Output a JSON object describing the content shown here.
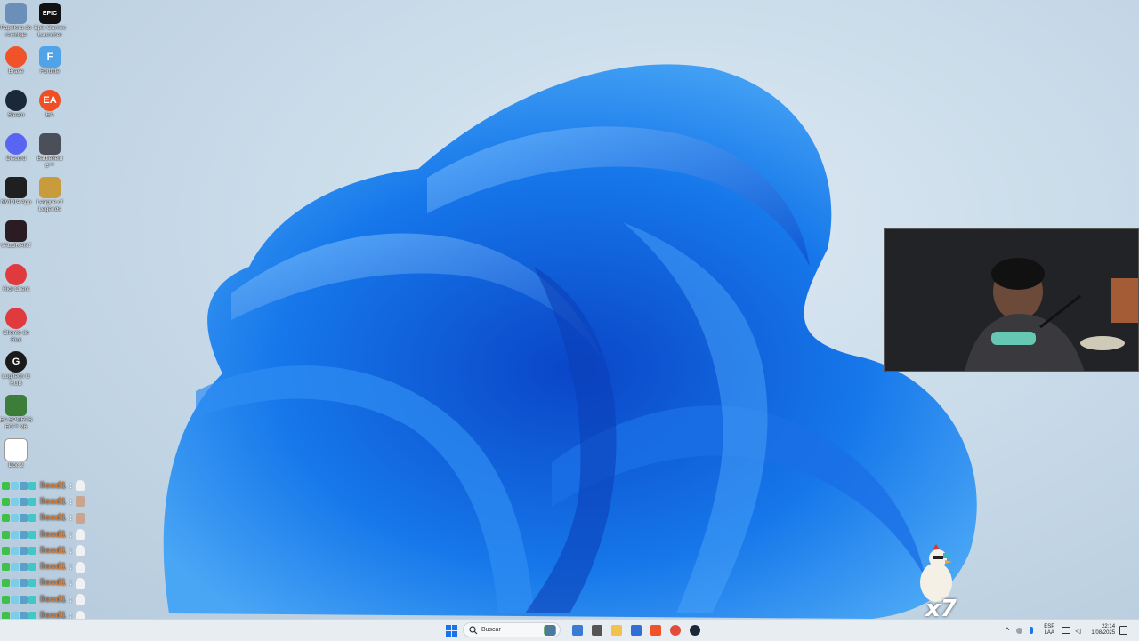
{
  "desktop_icons": [
    {
      "label": "Papelera de reciclaje",
      "icon": "recycle-bin-icon",
      "color": "#6b8fb8"
    },
    {
      "label": "Epic Games Launcher",
      "icon": "epic-games-icon",
      "color": "#111111",
      "glyph": "EPIC"
    },
    {
      "label": "Brave",
      "icon": "brave-icon",
      "color": "#f0522a"
    },
    {
      "label": "Fortnite",
      "icon": "fortnite-icon",
      "color": "#4fa3e6",
      "glyph": "F"
    },
    {
      "label": "Steam",
      "icon": "steam-icon",
      "color": "#1b2838"
    },
    {
      "label": "EA",
      "icon": "ea-icon",
      "color": "#f04e23",
      "glyph": "EA"
    },
    {
      "label": "Discord",
      "icon": "discord-icon",
      "color": "#5865f2"
    },
    {
      "label": "Battlefield 6™",
      "icon": "battlefield-icon",
      "color": "#4a4f5a"
    },
    {
      "label": "NVIDIA App",
      "icon": "nvidia-icon",
      "color": "#1f1f1f"
    },
    {
      "label": "League of Legends",
      "icon": "league-of-legends-icon",
      "color": "#c89b3c"
    },
    {
      "label": "VALORANT",
      "icon": "valorant-icon",
      "color": "#2b1b22"
    },
    {
      "label": "Riot Client",
      "icon": "riot-client-icon",
      "color": "#e03a3e"
    },
    {
      "label": "Cliente de Riot",
      "icon": "riot-client-icon",
      "color": "#e03a3e"
    },
    {
      "label": "Logitech G HUB",
      "icon": "logitech-g-icon",
      "color": "#1a1a1a",
      "glyph": "G"
    },
    {
      "label": "EA SPORTS FC™ 26",
      "icon": "ea-sports-fc-icon",
      "color": "#3c7d3a"
    },
    {
      "label": "Doc 2",
      "icon": "document-icon",
      "color": "#ffffff"
    }
  ],
  "webcam": {
    "label": "webcam feed"
  },
  "chat": {
    "username_color": "#e07b2c",
    "messages": [
      {
        "user": "lloxd1",
        "emote": "hand"
      },
      {
        "user": "lloxd1",
        "emote": "face"
      },
      {
        "user": "lloxd1",
        "emote": "face"
      },
      {
        "user": "lloxd1",
        "emote": "hand"
      },
      {
        "user": "lloxd1",
        "emote": "hand"
      },
      {
        "user": "lloxd1",
        "emote": "hand"
      },
      {
        "user": "lloxd1",
        "emote": "hand"
      },
      {
        "user": "lloxd1",
        "emote": "hand"
      },
      {
        "user": "lloxd1",
        "emote": "hand"
      }
    ]
  },
  "mascot": {
    "counter": "x7"
  },
  "taskbar": {
    "search_label": "Buscar",
    "apps": [
      "file-explorer-icon",
      "copilot-icon",
      "task-view-icon",
      "folder-icon",
      "store-icon",
      "brave-icon",
      "chrome-icon",
      "steam-icon"
    ],
    "tray": {
      "language_top": "ESP",
      "language_bottom": "LAA",
      "time": "22:14",
      "date": "1/08/2025"
    }
  }
}
